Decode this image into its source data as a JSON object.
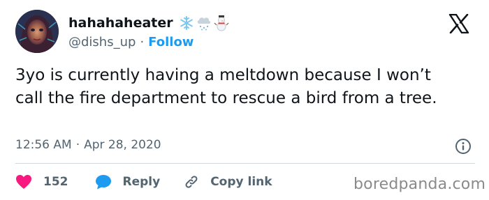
{
  "author": {
    "display_name": "hahahaheater",
    "handle": "@dishs_up",
    "separator": "·",
    "follow_label": "Follow",
    "name_emojis": [
      "snowflake",
      "cloud-with-snow",
      "snowman"
    ]
  },
  "tweet": {
    "text": "3yo is currently having a meltdown because I won’t call the fire department to rescue a bird from a tree.",
    "time": "12:56 AM",
    "time_separator": "·",
    "date": "Apr 28, 2020"
  },
  "actions": {
    "like_count": "152",
    "reply_label": "Reply",
    "copy_link_label": "Copy link"
  },
  "watermark": "boredpanda.com",
  "icons": {
    "platform": "x-logo-icon",
    "info": "info-icon",
    "like": "heart-icon",
    "reply": "reply-bubble-icon",
    "copy_link": "link-icon"
  },
  "colors": {
    "text": "#0f1419",
    "secondary": "#536471",
    "link": "#1d9bf0",
    "like": "#f91880",
    "reply": "#1d9bf0",
    "divider": "#cfd9de"
  }
}
